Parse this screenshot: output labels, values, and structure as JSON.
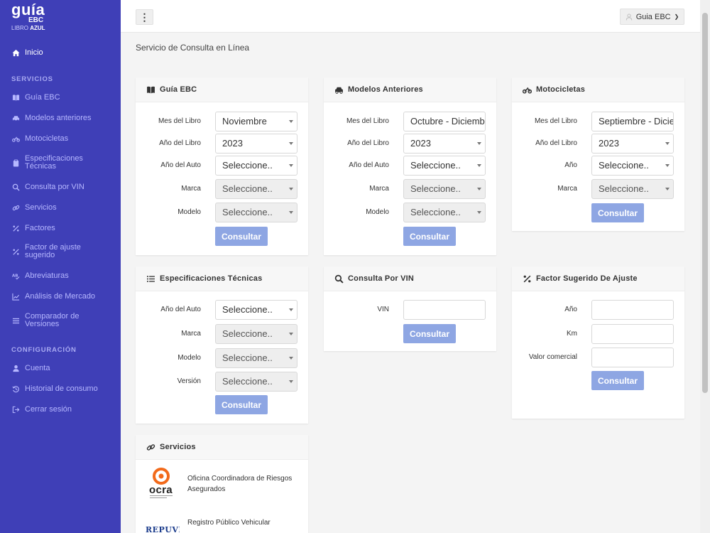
{
  "logo": {
    "main": "guía",
    "ebc": "EBC",
    "sub_a": "LIBRO ",
    "sub_b": "AZUL"
  },
  "sidebar": {
    "home": "Inicio",
    "section_services": "SERVICIOS",
    "items": [
      {
        "label": "Guía EBC",
        "icon": "book-icon"
      },
      {
        "label": "Modelos anteriores",
        "icon": "car-icon"
      },
      {
        "label": "Motocicletas",
        "icon": "motorcycle-icon"
      },
      {
        "label": "Especificaciones Técnicas",
        "icon": "clipboard-icon"
      },
      {
        "label": "Consulta por VIN",
        "icon": "search-icon"
      },
      {
        "label": "Servicios",
        "icon": "link-icon"
      },
      {
        "label": "Factores",
        "icon": "percent-icon"
      },
      {
        "label": "Factor de ajuste sugerido",
        "icon": "percent-icon"
      },
      {
        "label": "Abreviaturas",
        "icon": "spellcheck-icon"
      },
      {
        "label": "Análisis de Mercado",
        "icon": "chart-line-icon"
      },
      {
        "label": "Comparador de Versiones",
        "icon": "list-icon"
      }
    ],
    "section_config": "CONFIGURACIÓN",
    "config_items": [
      {
        "label": "Cuenta",
        "icon": "user-icon"
      },
      {
        "label": "Historial de consumo",
        "icon": "history-icon"
      },
      {
        "label": "Cerrar sesión",
        "icon": "sign-out-icon"
      }
    ]
  },
  "topbar": {
    "menu_glyph": "⋮",
    "user_label": "Guia EBC"
  },
  "page_title": "Servicio de Consulta en Línea",
  "panels": {
    "guia": {
      "title": "Guía EBC",
      "labels": {
        "mes": "Mes del Libro",
        "anio_libro": "Año del Libro",
        "anio_auto": "Año del Auto",
        "marca": "Marca",
        "modelo": "Modelo"
      },
      "values": {
        "mes": "Noviembre",
        "anio_libro": "2023",
        "anio_auto": "Seleccione..",
        "marca": "Seleccione..",
        "modelo": "Seleccione.."
      },
      "button": "Consultar"
    },
    "modelos": {
      "title": "Modelos Anteriores",
      "labels": {
        "mes": "Mes del Libro",
        "anio_libro": "Año del Libro",
        "anio_auto": "Año del Auto",
        "marca": "Marca",
        "modelo": "Modelo"
      },
      "values": {
        "mes": "Octubre - Diciembre",
        "anio_libro": "2023",
        "anio_auto": "Seleccione..",
        "marca": "Seleccione..",
        "modelo": "Seleccione.."
      },
      "button": "Consultar"
    },
    "motos": {
      "title": "Motocicletas",
      "labels": {
        "mes": "Mes del Libro",
        "anio_libro": "Año del Libro",
        "anio": "Año",
        "marca": "Marca"
      },
      "values": {
        "mes": "Septiembre - Diciembre",
        "anio_libro": "2023",
        "anio": "Seleccione..",
        "marca": "Seleccione.."
      },
      "button": "Consultar"
    },
    "specs": {
      "title": "Especificaciones Técnicas",
      "labels": {
        "anio_auto": "Año del Auto",
        "marca": "Marca",
        "modelo": "Modelo",
        "version": "Versión"
      },
      "values": {
        "anio_auto": "Seleccione..",
        "marca": "Seleccione..",
        "modelo": "Seleccione..",
        "version": "Seleccione.."
      },
      "button": "Consultar"
    },
    "vin": {
      "title": "Consulta Por VIN",
      "labels": {
        "vin": "VIN"
      },
      "placeholder": "",
      "button": "Consultar"
    },
    "factor": {
      "title": "Factor Sugerido De Ajuste",
      "labels": {
        "anio": "Año",
        "km": "Km",
        "valor": "Valor comercial"
      },
      "button": "Consultar"
    },
    "servicios": {
      "title": "Servicios",
      "items": [
        {
          "logo_text": "ocra",
          "text": "Oficina Coordinadora de Riesgos Asegurados"
        },
        {
          "logo_text": "REPUVE",
          "text": "Registro Público Vehicular"
        }
      ]
    }
  },
  "colors": {
    "sidebar": "#3f3fb7",
    "button": "#8ea6e3",
    "ocra_orange": "#f26a1b"
  }
}
